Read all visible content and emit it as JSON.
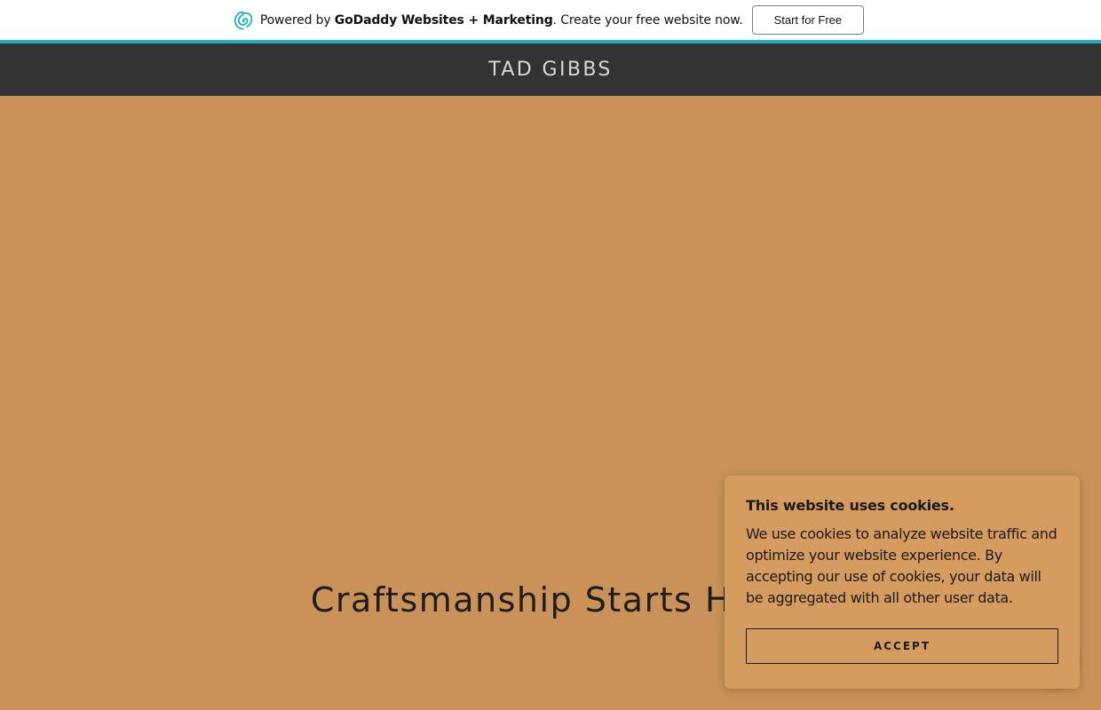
{
  "promo": {
    "prefix": "Powered by ",
    "brand": "GoDaddy Websites + Marketing",
    "suffix": ". Create your free website now.",
    "cta_label": "Start for Free",
    "logo_icon": "godaddy-logo-icon",
    "accent_color": "#1bb1bf"
  },
  "header": {
    "site_title": "TAD GIBBS",
    "background_color": "#333333"
  },
  "hero": {
    "heading": "Craftsmanship Starts Here",
    "background_color": "#ca9258"
  },
  "cookie_banner": {
    "title": "This website uses cookies.",
    "body": "We use cookies to analyze website traffic and optimize your website experience. By accepting our use of cookies, your data will be aggregated with all other user data.",
    "accept_label": "ACCEPT"
  },
  "chat_widget": {
    "icon": "chat-bubble-icon"
  }
}
